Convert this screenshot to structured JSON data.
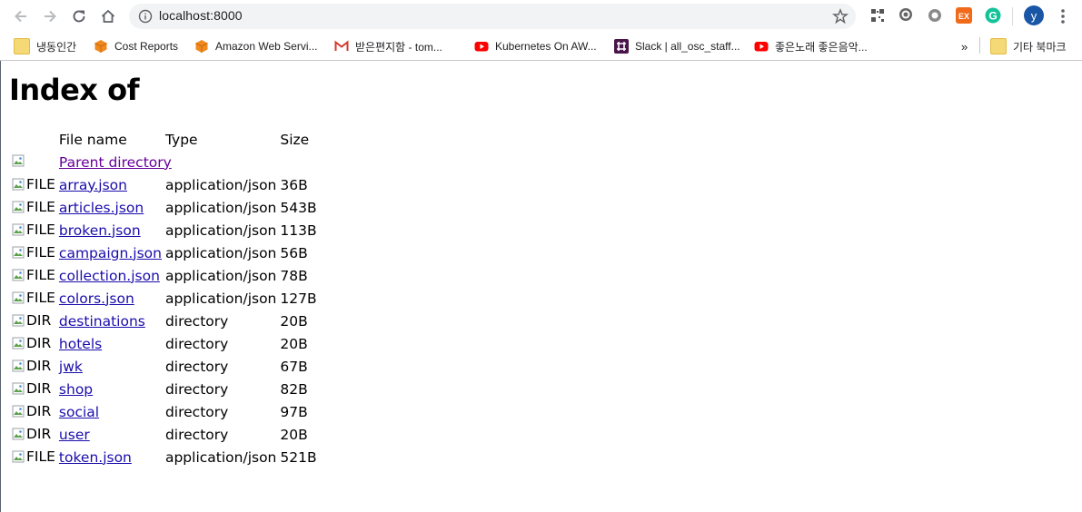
{
  "browser": {
    "url": "localhost:8000",
    "profile_initial": "y",
    "extensions": [
      "qr-code-icon",
      "speech-bubble-icon",
      "puzzle-gear-icon",
      "ex-extension-icon",
      "grammarly-icon"
    ],
    "bookmarks": [
      {
        "label": "냉동인간",
        "icon": "folder-icon"
      },
      {
        "label": "Cost Reports",
        "icon": "aws-cube-icon"
      },
      {
        "label": "Amazon Web Servi...",
        "icon": "aws-cube-icon"
      },
      {
        "label": "받은편지함 - tom...",
        "icon": "gmail-icon"
      },
      {
        "label": "Kubernetes On AW...",
        "icon": "youtube-icon"
      },
      {
        "label": "Slack | all_osc_staff...",
        "icon": "slack-icon"
      },
      {
        "label": "좋은노래 좋은음악...",
        "icon": "youtube-icon"
      }
    ],
    "overflow": "»",
    "other_bookmarks": "기타 북마크"
  },
  "page": {
    "title": "Index of",
    "headers": {
      "name": "File name",
      "type": "Type",
      "size": "Size"
    },
    "parent": {
      "label": "Parent directory"
    },
    "rows": [
      {
        "icon": "FILE",
        "name": "array.json",
        "type": "application/json",
        "size": "36B"
      },
      {
        "icon": "FILE",
        "name": "articles.json",
        "type": "application/json",
        "size": "543B"
      },
      {
        "icon": "FILE",
        "name": "broken.json",
        "type": "application/json",
        "size": "113B"
      },
      {
        "icon": "FILE",
        "name": "campaign.json",
        "type": "application/json",
        "size": "56B"
      },
      {
        "icon": "FILE",
        "name": "collection.json",
        "type": "application/json",
        "size": "78B"
      },
      {
        "icon": "FILE",
        "name": "colors.json",
        "type": "application/json",
        "size": "127B"
      },
      {
        "icon": "DIR",
        "name": "destinations",
        "type": "directory",
        "size": "20B"
      },
      {
        "icon": "DIR",
        "name": "hotels",
        "type": "directory",
        "size": "20B"
      },
      {
        "icon": "DIR",
        "name": "jwk",
        "type": "directory",
        "size": "67B"
      },
      {
        "icon": "DIR",
        "name": "shop",
        "type": "directory",
        "size": "82B"
      },
      {
        "icon": "DIR",
        "name": "social",
        "type": "directory",
        "size": "97B"
      },
      {
        "icon": "DIR",
        "name": "user",
        "type": "directory",
        "size": "20B"
      },
      {
        "icon": "FILE",
        "name": "token.json",
        "type": "application/json",
        "size": "521B"
      }
    ]
  },
  "colors": {
    "link": "#1a0dab",
    "visited": "#660099",
    "profile": "#1a56a6"
  }
}
